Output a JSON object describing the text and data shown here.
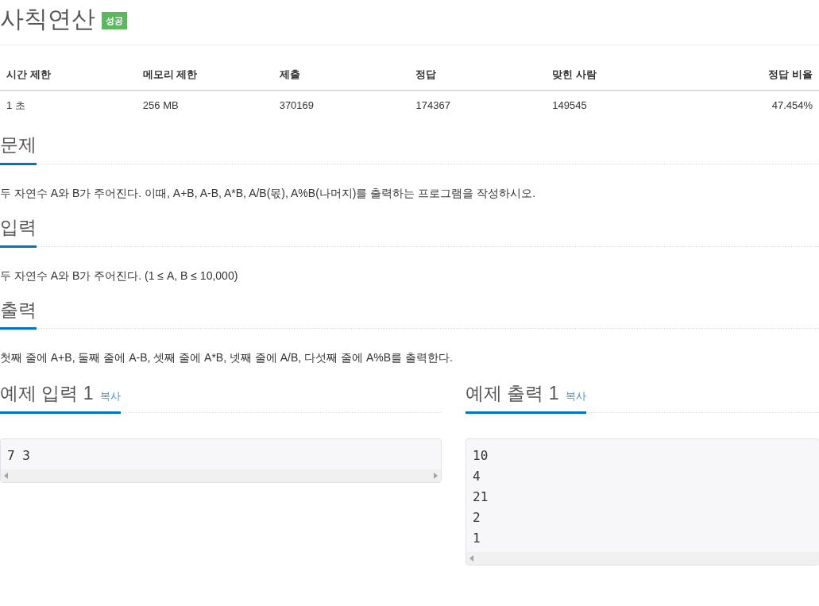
{
  "title": "사칙연산",
  "badge": "성공",
  "stats": {
    "columns": [
      "시간 제한",
      "메모리 제한",
      "제출",
      "정답",
      "맞힌 사람",
      "정답 비율"
    ],
    "row": [
      "1 초",
      "256 MB",
      "370169",
      "174367",
      "149545",
      "47.454%"
    ]
  },
  "sections": [
    {
      "heading": "문제",
      "body": "두 자연수 A와 B가 주어진다. 이때, A+B, A-B, A*B, A/B(몫), A%B(나머지)를 출력하는 프로그램을 작성하시오."
    },
    {
      "heading": "입력",
      "body": "두 자연수 A와 B가 주어진다. (1 ≤ A, B ≤ 10,000)"
    },
    {
      "heading": "출력",
      "body": "첫째 줄에 A+B, 둘째 줄에 A-B, 셋째 줄에 A*B, 넷째 줄에 A/B, 다섯째 줄에 A%B를 출력한다."
    }
  ],
  "samples": [
    {
      "heading": "예제 입력 1",
      "copy": "복사",
      "lines": [
        "7 3"
      ]
    },
    {
      "heading": "예제 출력 1",
      "copy": "복사",
      "lines": [
        "10",
        "4",
        "21",
        "2",
        "1"
      ]
    }
  ]
}
